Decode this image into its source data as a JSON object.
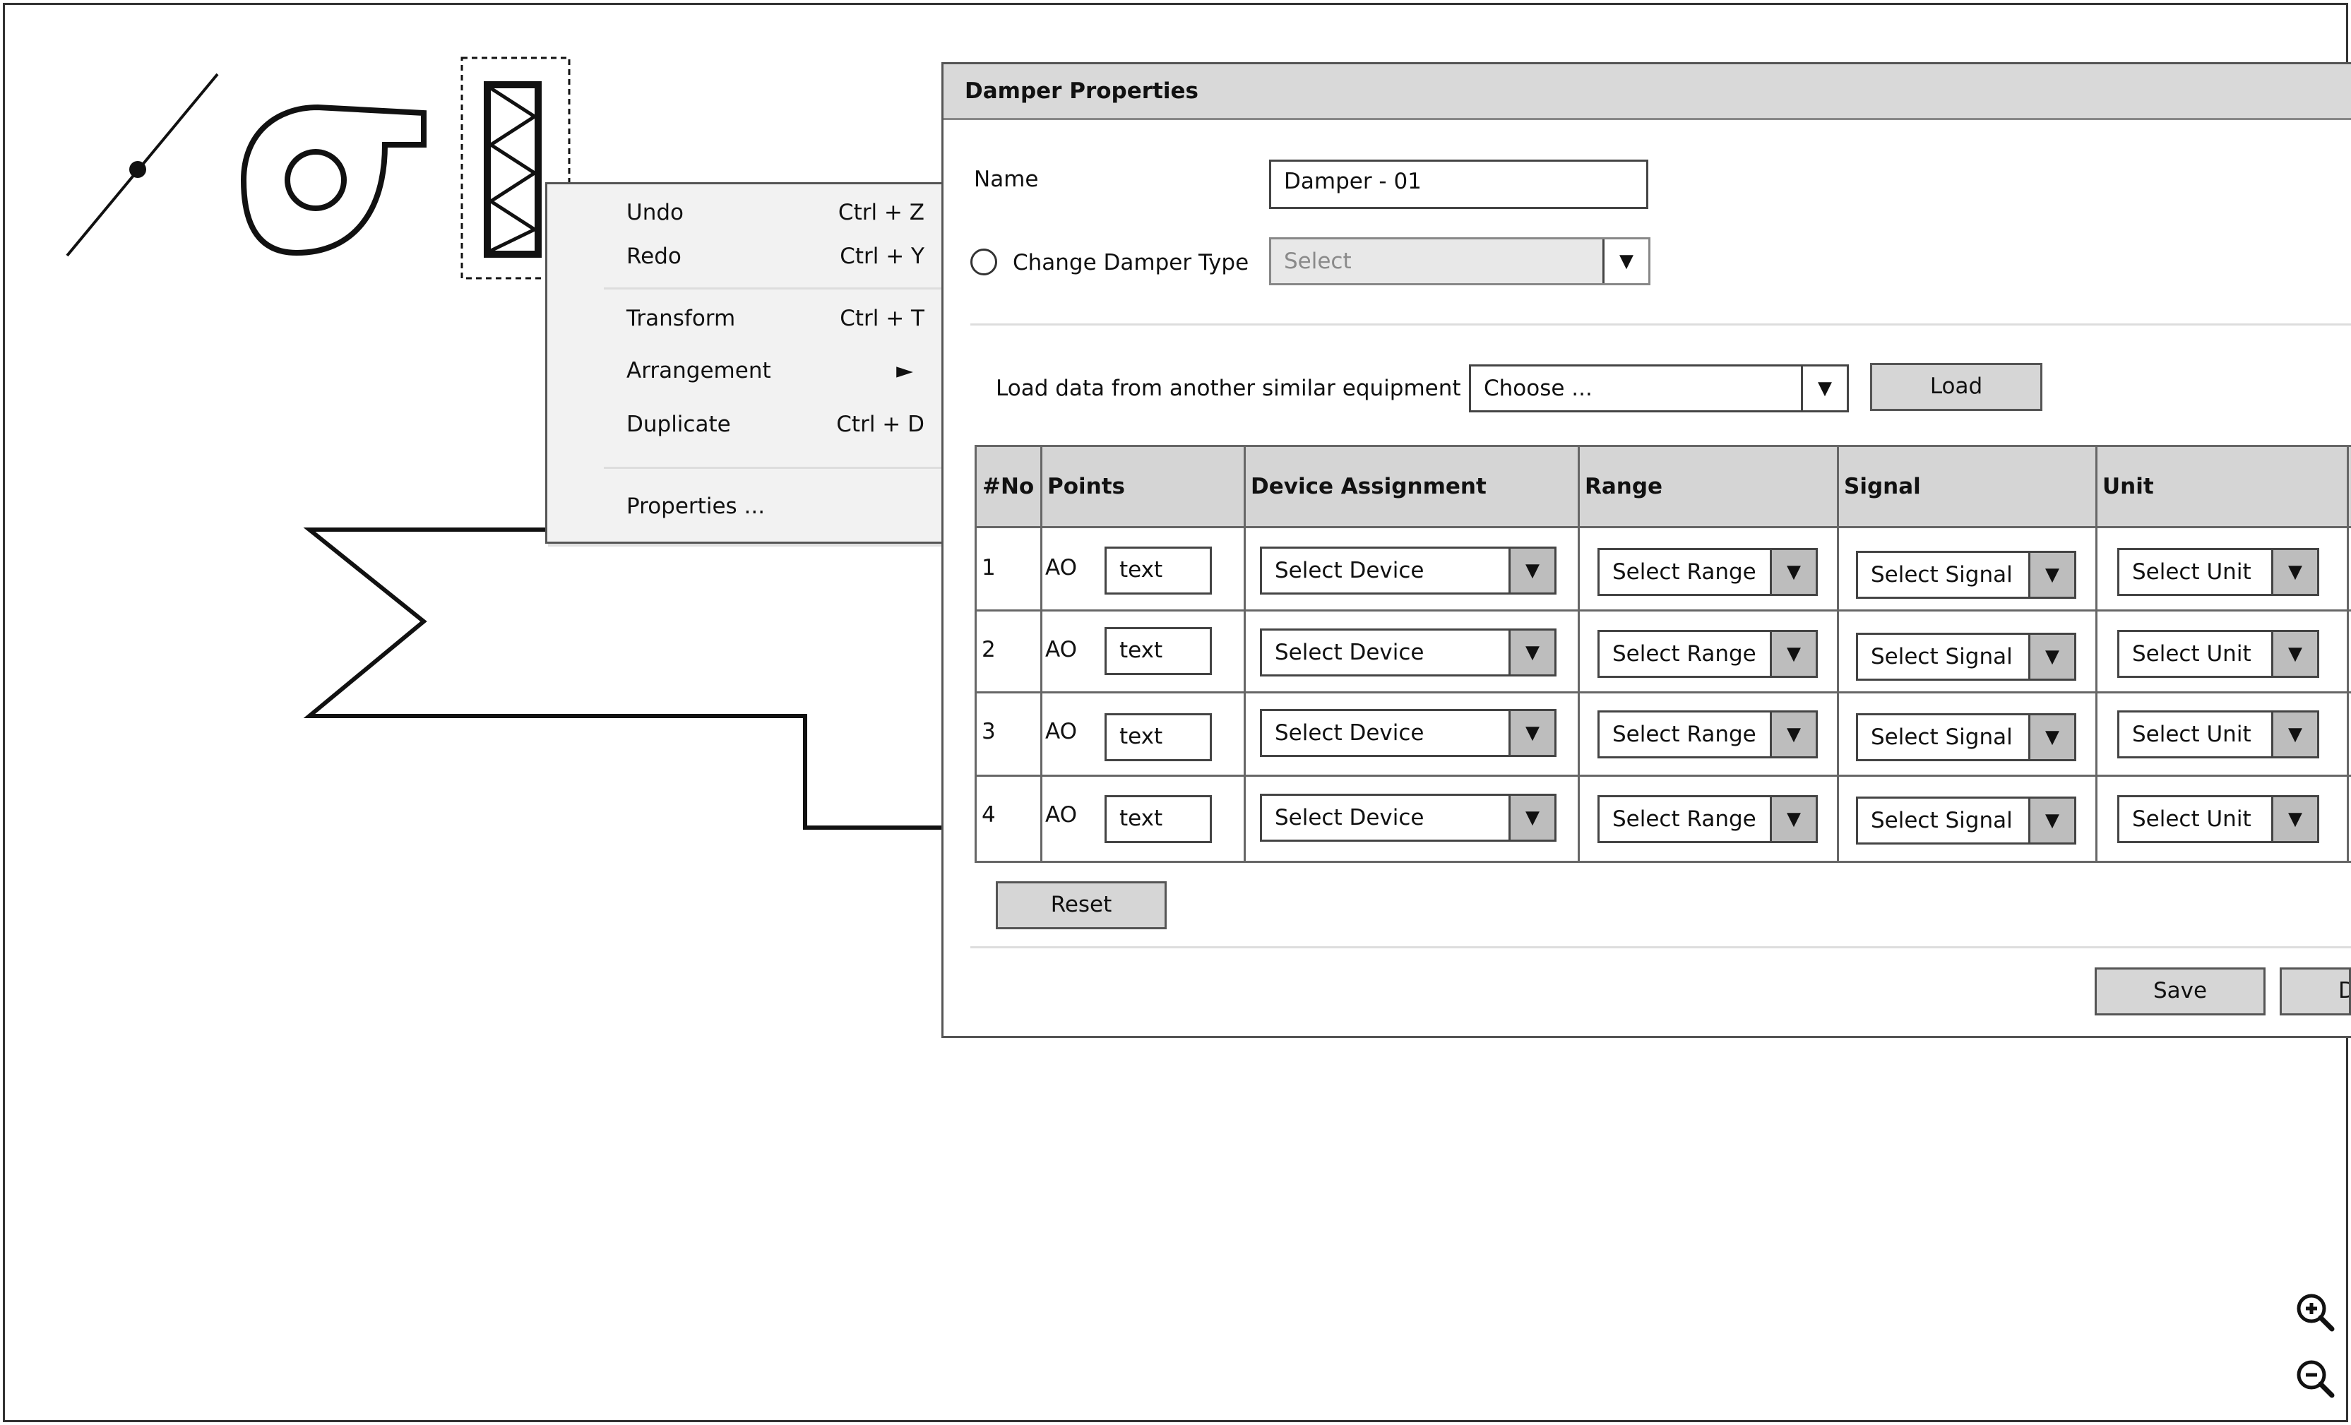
{
  "context_menu": {
    "items": [
      {
        "label": "Undo",
        "shortcut": "Ctrl + Z"
      },
      {
        "label": "Redo",
        "shortcut": "Ctrl + Y"
      },
      {
        "label": "Transform",
        "shortcut": "Ctrl + T"
      },
      {
        "label": "Arrangement",
        "shortcut": "►"
      },
      {
        "label": "Duplicate",
        "shortcut": "Ctrl + D"
      },
      {
        "label": "Properties ...",
        "shortcut": ""
      }
    ]
  },
  "dialog": {
    "title": "Damper Properties",
    "name_label": "Name",
    "name_value": "Damper - 01",
    "change_type_label": "Change Damper Type",
    "type_select": "Select",
    "load_label": "Load data from another similar equipment",
    "load_select": "Choose ...",
    "load_button": "Load",
    "reset_button": "Reset",
    "save_button": "Save",
    "cut_button": "D"
  },
  "table": {
    "headers": [
      "#No",
      "Points",
      "Device Assignment",
      "Range",
      "Signal",
      "Unit"
    ],
    "rows": [
      {
        "no": "1",
        "point": "AO",
        "text": "text",
        "device": "Select Device",
        "range": "Select Range",
        "signal": "Select Signal",
        "unit": "Select Unit"
      },
      {
        "no": "2",
        "point": "AO",
        "text": "text",
        "device": "Select Device",
        "range": "Select Range",
        "signal": "Select Signal",
        "unit": "Select Unit"
      },
      {
        "no": "3",
        "point": "AO",
        "text": "text",
        "device": "Select Device",
        "range": "Select Range",
        "signal": "Select Signal",
        "unit": "Select Unit"
      },
      {
        "no": "4",
        "point": "AO",
        "text": "text",
        "device": "Select Device",
        "range": "Select Range",
        "signal": "Select Signal",
        "unit": "Select Unit"
      }
    ]
  },
  "icons": {
    "dropdown": "▼",
    "zoom_in": "zoom-in-icon",
    "zoom_out": "zoom-out-icon"
  }
}
